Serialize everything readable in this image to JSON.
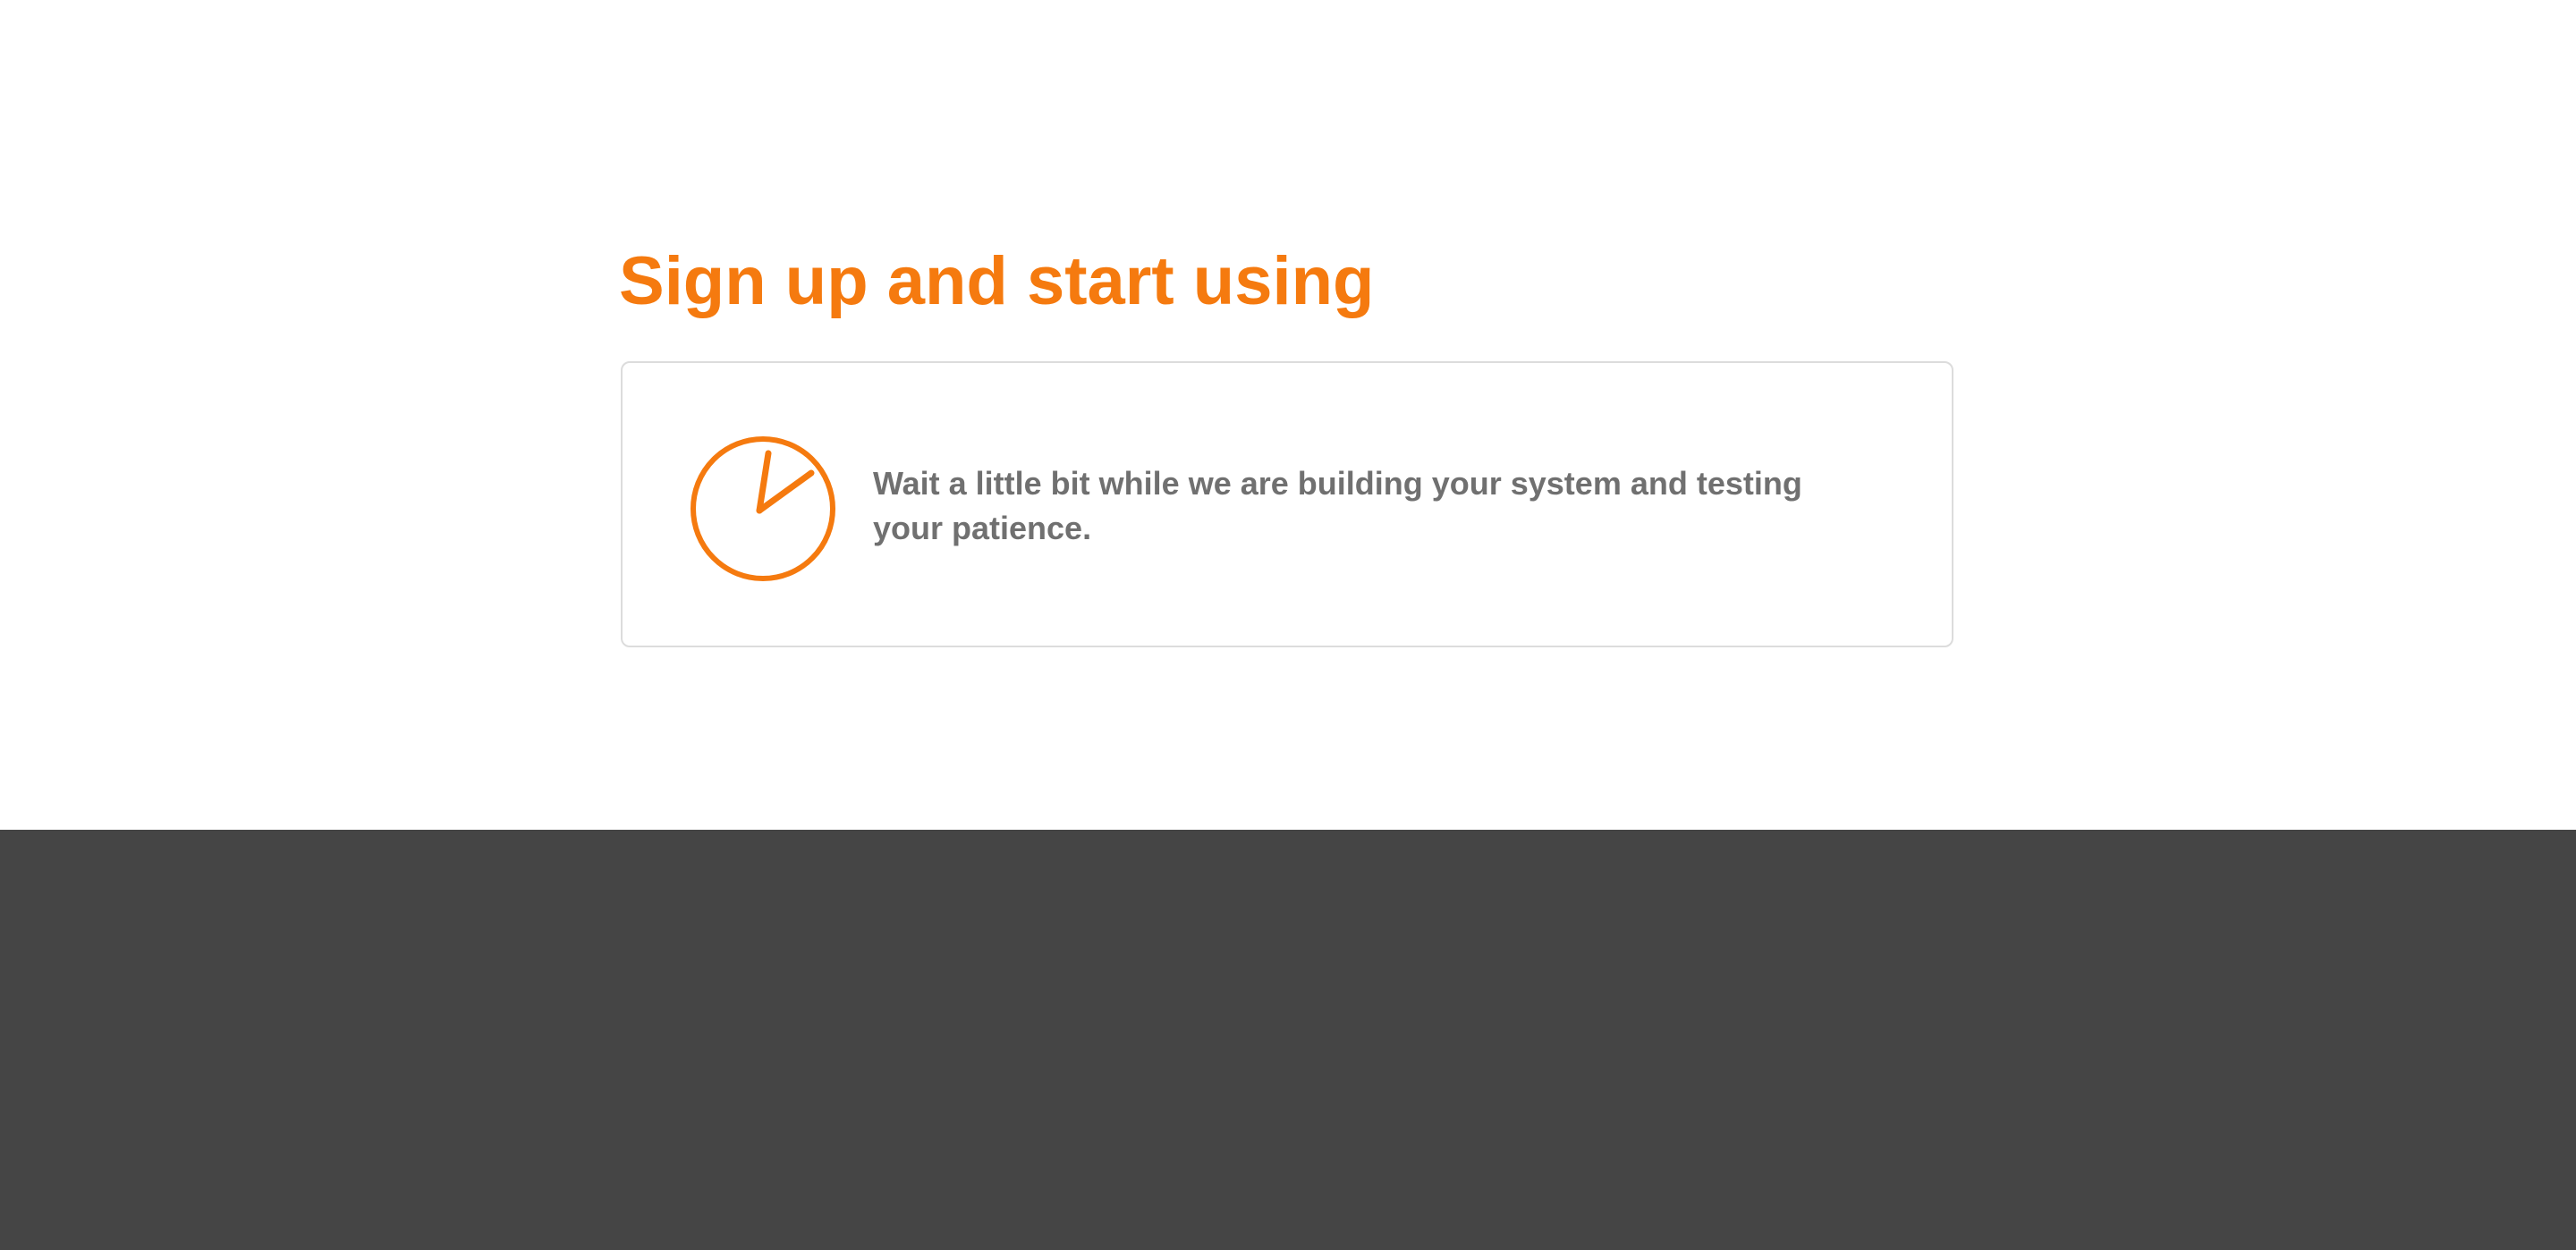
{
  "signup": {
    "title": "Sign up and start using",
    "status_message": "Wait a little bit while we are building your system and testing your patience.",
    "status_icon": "clock-icon"
  },
  "colors": {
    "accent": "#f57a0f",
    "text_muted": "#707070",
    "card_border": "#dcdcdc",
    "page_background": "#ffffff",
    "footer_background": "#454545"
  }
}
